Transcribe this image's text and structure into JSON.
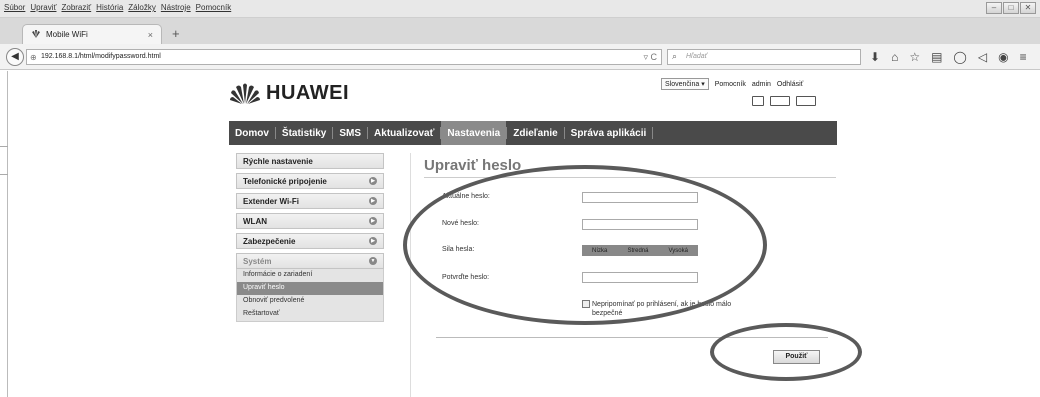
{
  "browser": {
    "menus": [
      "Súbor",
      "Upraviť",
      "Zobraziť",
      "História",
      "Záložky",
      "Nástroje",
      "Pomocník"
    ],
    "tab_title": "Mobile WiFi",
    "tab_close": "×",
    "new_tab": "+",
    "url": "192.168.8.1/html/modifypassword.html",
    "search_placeholder": "Hľadať",
    "window_controls": [
      "–",
      "□",
      "✕"
    ]
  },
  "topbar": {
    "language": "Slovenčina",
    "links": [
      "Pomocník",
      "admin",
      "Odhlásiť"
    ]
  },
  "logo": {
    "brand": "HUAWEI"
  },
  "main_nav": [
    {
      "label": "Domov",
      "active": false
    },
    {
      "label": "Štatistiky",
      "active": false
    },
    {
      "label": "SMS",
      "active": false
    },
    {
      "label": "Aktualizovať",
      "active": false
    },
    {
      "label": "Nastavenia",
      "active": true
    },
    {
      "label": "Zdieľanie",
      "active": false
    },
    {
      "label": "Správa aplikácii",
      "active": false
    }
  ],
  "side_menu": {
    "items": [
      "Rýchle nastavenie",
      "Telefonické pripojenie",
      "Extender Wi-Fi",
      "WLAN",
      "Zabezpečenie"
    ],
    "system_label": "Systém",
    "system_items": [
      "Informácie o zariadení",
      "Upraviť heslo",
      "Obnoviť predvolené",
      "Reštartovať"
    ]
  },
  "form": {
    "title": "Upraviť heslo",
    "current_label": "Aktuálne heslo:",
    "new_label": "Nové heslo:",
    "strength_label": "Sila hesla:",
    "strength_levels": [
      "Nízka",
      "Stredná",
      "Vysoká"
    ],
    "confirm_label": "Potvrďte heslo:",
    "checkbox_text": "Nepripomínať po prihlásení, ak je heslo málo bezpečné",
    "apply_label": "Použiť"
  }
}
